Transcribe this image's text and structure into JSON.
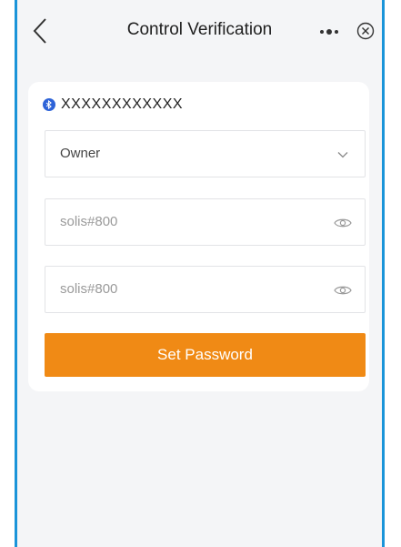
{
  "nav": {
    "title": "Control Verification"
  },
  "device": {
    "name": "XXXXXXXXXXXX",
    "icon": "bluetooth-icon"
  },
  "form": {
    "role_value": "Owner",
    "password_value": "solis#800",
    "confirm_password_value": "solis#800",
    "submit_label": "Set Password"
  },
  "colors": {
    "accent": "#f08a15",
    "bluetooth": "#2d63d8",
    "frame_border": "#1a94d9"
  }
}
